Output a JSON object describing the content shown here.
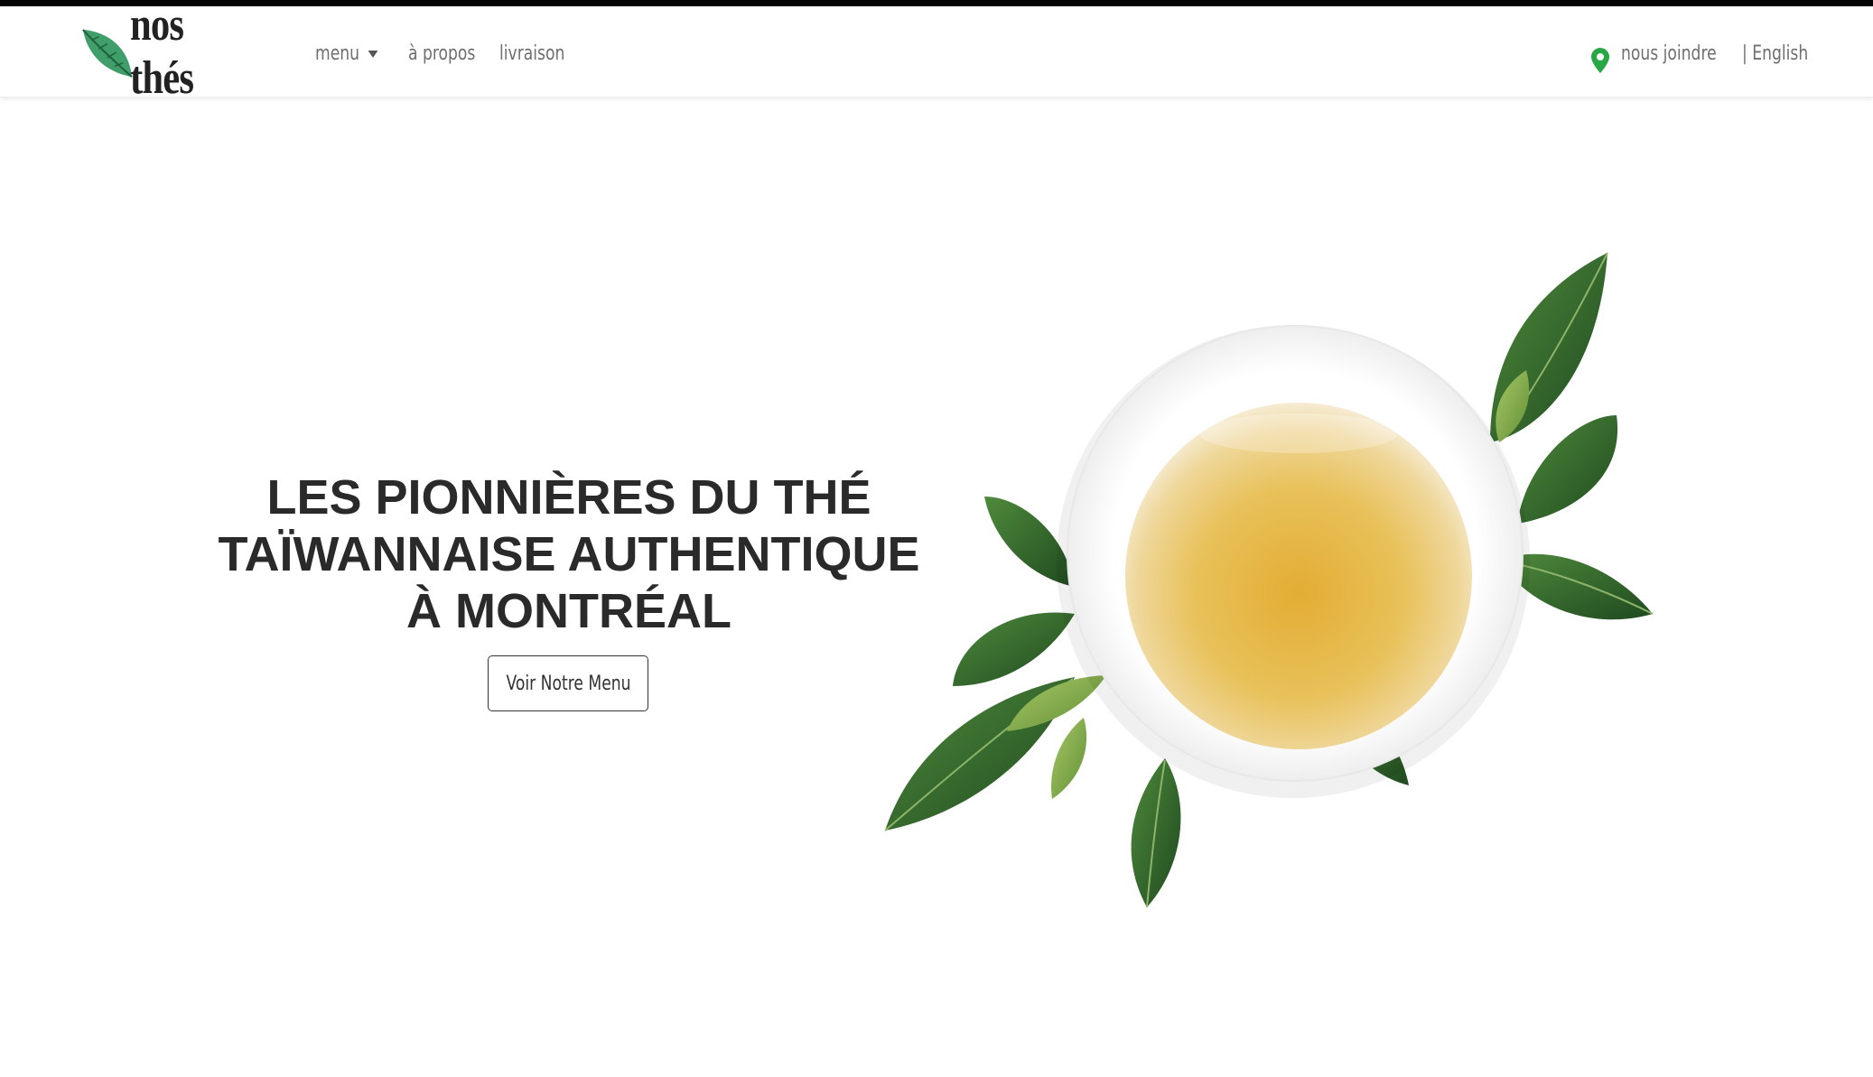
{
  "brand": {
    "name": "nos thés",
    "leaf_color": "#2e8b57"
  },
  "nav": {
    "menu_label": "menu",
    "about_label": "à propos",
    "delivery_label": "livraison",
    "contact_label": "nous joindre",
    "language_label": "| English"
  },
  "hero": {
    "title_lines": [
      "LES PIONNIÈRES DU THÉ",
      "TAÏWANNAISE AUTHENTIQUE",
      "À MONTRÉAL"
    ],
    "cta_label": "Voir Notre Menu"
  },
  "colors": {
    "accent_green": "#28a745",
    "leaf_dark": "#2f5e2c",
    "tea": "#e2b84a"
  },
  "icons": {
    "pin": "map-pin-icon",
    "caret": "chevron-down-icon"
  }
}
